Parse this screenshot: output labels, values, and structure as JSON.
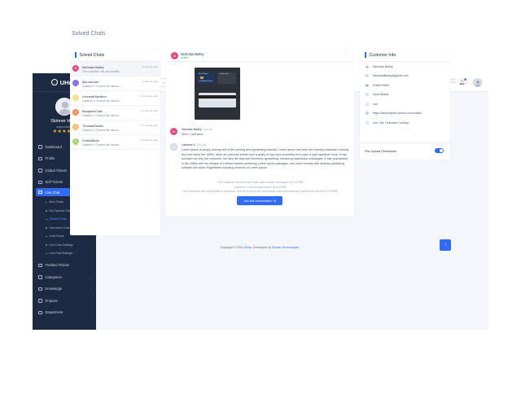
{
  "app": {
    "name": "UHelp"
  },
  "profile": {
    "name": "Skinner Harry",
    "role": "superadmin",
    "stars": "★★★★★"
  },
  "nav": {
    "items": [
      {
        "label": "Dashboard",
        "icon": "dashboard-icon"
      },
      {
        "label": "Profile",
        "icon": "user-icon"
      },
      {
        "label": "Global Tickets",
        "icon": "tickets-icon",
        "caret": "›"
      },
      {
        "label": "Self Tickets",
        "icon": "tickets-icon",
        "caret": "›"
      }
    ],
    "live_chat": {
      "label": "Live Chat",
      "caret": "⌄"
    },
    "live_chat_sub": [
      {
        "label": "New Chats"
      },
      {
        "label": "My Opened Chats"
      },
      {
        "label": "Solved Chats"
      },
      {
        "label": "Operators Chat"
      },
      {
        "label": "Chat Flows"
      },
      {
        "label": "Live Chat Settings"
      },
      {
        "label": "Live Chat Ratings"
      }
    ],
    "items_after": [
      {
        "label": "Trashed Tickets",
        "icon": "trash-icon"
      },
      {
        "label": "Categories",
        "icon": "categories-icon",
        "caret": "›"
      },
      {
        "label": "Knowledge",
        "icon": "book-icon",
        "caret": "›"
      },
      {
        "label": "Projects",
        "icon": "projects-icon"
      },
      {
        "label": "Department",
        "icon": "department-icon"
      }
    ]
  },
  "header": {
    "menu_icon": "☰",
    "create_ticket": "Create Ticket",
    "home_page": "Home Page",
    "language": "English",
    "notification_count": "0"
  },
  "page": {
    "title": "Solved Chats"
  },
  "solved_list": {
    "title": "Solved Chats",
    "chats": [
      {
        "initial": "N",
        "name": "Nicholas Bailey",
        "message": "The customer did not provide...",
        "time": "5 minutes ago",
        "color": "#e14b7f"
      },
      {
        "initial": "",
        "name": "McLeanJoe",
        "message": "Lakshmi V Solved the discus...",
        "time": "8 minutes ago",
        "color": "#8e6ee8"
      },
      {
        "initial": "",
        "name": "LeonardHamilton",
        "message": "Lakshmi V Solved the discus...",
        "time": "12 minutes ago",
        "color": "#f7e18a"
      },
      {
        "initial": "B",
        "name": "BenjaminClark",
        "message": "Lakshmi V Solved the discus...",
        "time": "13 minutes ago",
        "color": "#ff8a4c"
      },
      {
        "initial": "T",
        "name": "ThomasDavies",
        "message": "Lakshmi V Solved the discus...",
        "time": "17 minutes ago",
        "color": "#f3c26b"
      },
      {
        "initial": "F",
        "name": "FrankMartin",
        "message": "Lakshmi V Solved the discus...",
        "time": "22 minutes ago",
        "color": "#a3d96b"
      }
    ]
  },
  "conversation": {
    "contact": {
      "initial": "N",
      "name": "Nicholas Bailey",
      "status": "online"
    },
    "image_labels": {
      "bank": "Bank Name",
      "credit": "Credit Card",
      "holder": "Cardholder Name"
    },
    "messages": [
      {
        "initial": "N",
        "sender": "Nicholas Bailey",
        "time": "3:04 PM",
        "text": "Sure ! I will send."
      },
      {
        "initial": "",
        "sender": "Lakshmi V",
        "time": "3:04 PM",
        "text": "Lorem Ipsum is simply dummy text of the printing and typesetting industry. Lorem Ipsum has been the industry's standard dummy text ever since the 1500s, when an unknown printer took a galley of type and scrambled it to make a type specimen book. It has survived not only five centuries, but also the leap into electronic typesetting, remaining essentially unchanged. It was popularised in the 1960s with the release of Letraset sheets containing Lorem Ipsum passages, and more recently with desktop publishing software like Aldus PageMaker including versions of Lorem Ipsum."
      }
    ],
    "system_notes": [
      "The customer received an email with unread messages at 6:57PM",
      "Lakshmi V left the discussion at 6:00PM",
      "The customer did not provide a response, and as a result the discussion was automatically marked as solved at 6:00PM."
    ],
    "join_button": "Join this conversation"
  },
  "customer_info": {
    "title": "Customer Info",
    "rows": [
      {
        "icon": "user-icon",
        "glyph": "◉",
        "value": "Nicholas Bailey"
      },
      {
        "icon": "mail-icon",
        "glyph": "✉",
        "value": "NicholasBailey@gmail.com"
      },
      {
        "icon": "phone-icon",
        "glyph": "☎",
        "value": "9180074692"
      },
      {
        "icon": "browser-icon",
        "glyph": "▭",
        "value": "Not A Brand"
      },
      {
        "icon": "device-icon",
        "glyph": "▯",
        "value": "null"
      },
      {
        "icon": "link-icon",
        "glyph": "⛓",
        "value": "https://devprojects.spruko.com/uhelp/"
      },
      {
        "icon": "location-icon",
        "glyph": "⌖",
        "value": "null, null, Unknown Country"
      }
    ]
  },
  "file_upload": {
    "label": "File Upload Permission",
    "enabled": true
  },
  "footer": {
    "prefix": "Copyright © 2024 ",
    "app": "Uhelp",
    "middle": ". Developed by ",
    "company": "Spruko Technologies"
  },
  "scroll_top_icon": "↑",
  "colors": {
    "accent": "#2f6bf5",
    "sidebar": "#1d2a43",
    "online": "#28c76f"
  }
}
